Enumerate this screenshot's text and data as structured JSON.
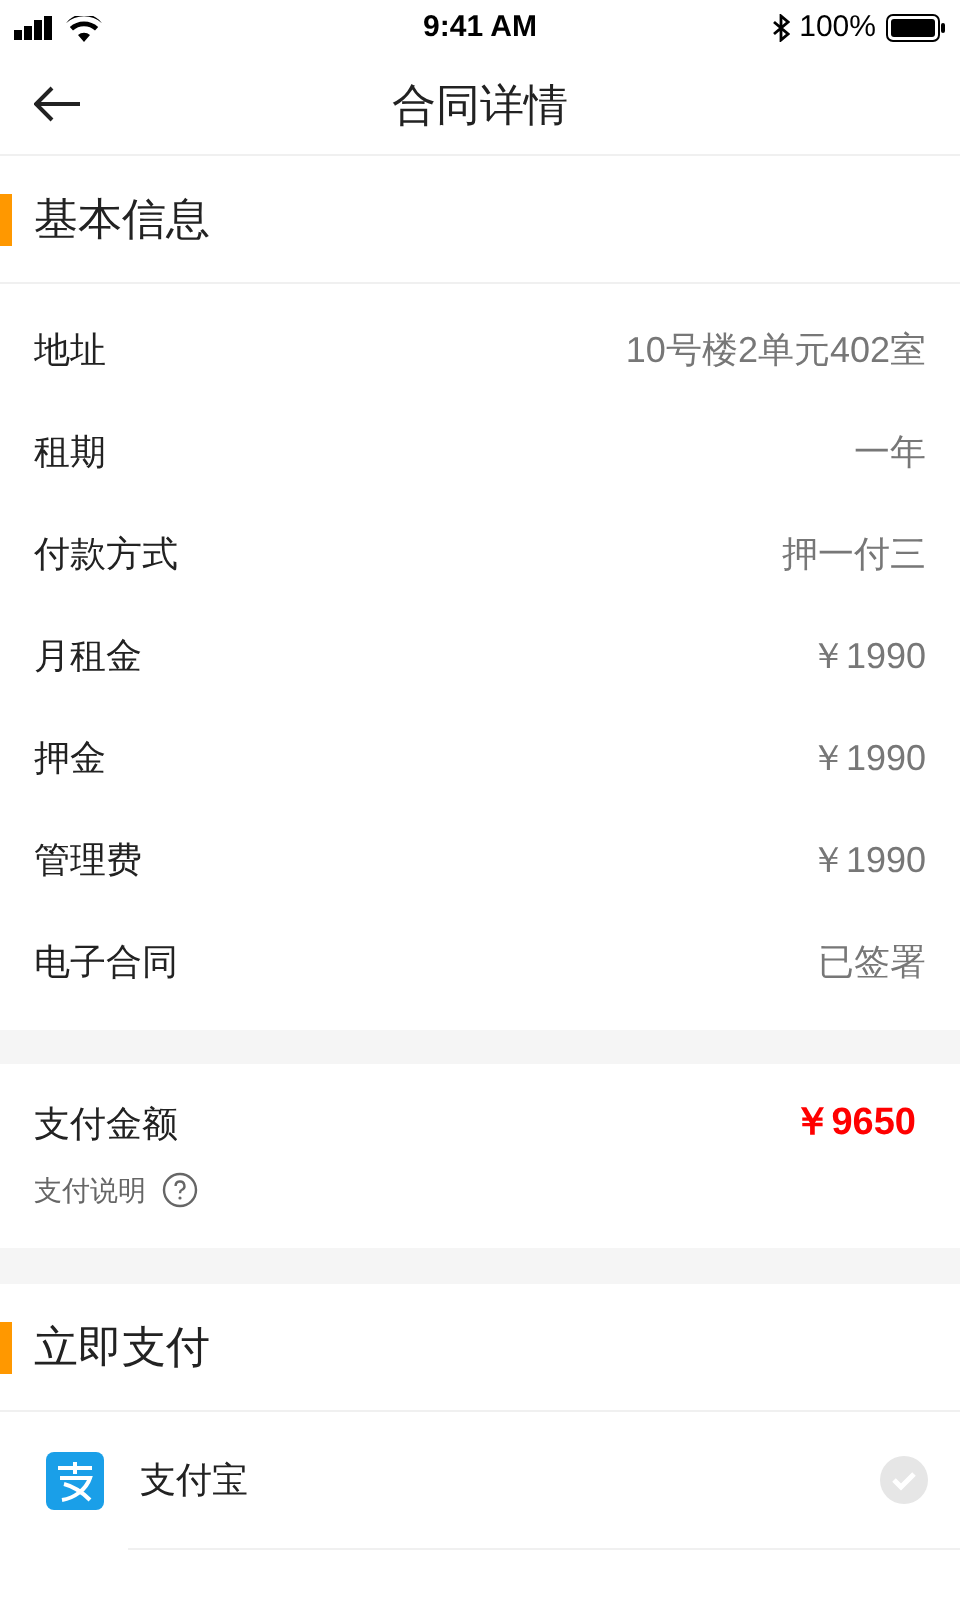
{
  "status_bar": {
    "time": "9:41 AM",
    "battery": "100%"
  },
  "nav": {
    "title": "合同详情"
  },
  "basic_info": {
    "title": "基本信息",
    "rows": [
      {
        "label": "地址",
        "value": "10号楼2单元402室"
      },
      {
        "label": "租期",
        "value": "一年"
      },
      {
        "label": "付款方式",
        "value": "押一付三"
      },
      {
        "label": "月租金",
        "value": "￥1990"
      },
      {
        "label": "押金",
        "value": "￥1990"
      },
      {
        "label": "管理费",
        "value": "￥1990"
      },
      {
        "label": "电子合同",
        "value": "已签署"
      }
    ]
  },
  "payment_amount": {
    "label": "支付金额",
    "value": "￥9650",
    "note": "支付说明"
  },
  "pay_now": {
    "title": "立即支付",
    "methods": [
      {
        "name": "支付宝",
        "selected": false
      }
    ]
  }
}
